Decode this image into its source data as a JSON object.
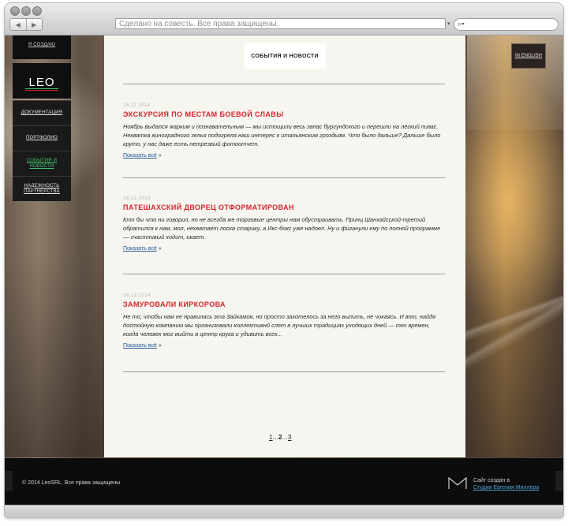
{
  "browser": {
    "address_text": "Сделано на совесть. Все права защищены.",
    "nav_back": "◀",
    "nav_forward": "▶",
    "search_icon": "search-icon",
    "addr_caret": "▾"
  },
  "site": {
    "top_link": "Я СОЗДАЮ",
    "logo_text": "LEO",
    "language_button": "IN ENGLISH",
    "nav": [
      {
        "label": "Документация"
      },
      {
        "label": "Портфолио"
      },
      {
        "label": "События и новости"
      },
      {
        "label": "Надежность партнерства"
      }
    ],
    "section_title": "События и новости",
    "posts": [
      {
        "date": "16.11.2014",
        "title": "ЭКСКУРСИЯ ПО МЕСТАМ БОЕВОЙ СЛАВЫ",
        "text": "Ноябрь выдался жарким и познавательным — мы истощили весь запас бургундского и перешли на лёгкий пивас. Нехватка виноградного зелья подогрела наш интерес к итальянским гроздьям. Что было дальше? Дальше было круто, у нас даже есть нетрезвый фотоотчет.",
        "more": "Показать всё",
        "arrow": "»"
      },
      {
        "date": "16.12.2014",
        "title": "ПАТЕШАХСКИЙ ДВОРЕЦ ОТФОРМАТИРОВАН",
        "text": "Кто бы что ни говорил, но не всегда же торговые центры нам обустраивать. Принц Шанхайсской-третий обратился к нам, мол, нехватает лоска старику, а Икс-бокс уже надоел. Ну и фиганули ему по полной программе — счастливый ходит, икает.",
        "more": "Показать всё",
        "arrow": "»"
      },
      {
        "date": "16.13.2014",
        "title": "ЗАМУРОВАЛИ КИРКОРОВА",
        "text": "Не то, чтобы нам не нравилась эта Зайкамоя, но просто захотелось за него выпить, не чокаясь. И вот, найдя достойную компанию мы организовали коллективнй слет в лучших традициях уходящих дней — тех времен, когда человек мог выйти в центр круга и удивить всех...",
        "more": "Показать всё",
        "arrow": "»"
      }
    ],
    "pagination": {
      "p1": "1",
      "sep1": "...",
      "p2": "2",
      "sep2": "...",
      "p3": "3"
    },
    "footer": {
      "copyright": "© 2014 LeoSRL. Все права защищены",
      "credit_line1": "Сайт создан в",
      "credit_link": "Студии Евгения Миллера"
    }
  },
  "colors": {
    "accent_red": "#d7262f",
    "active_nav": "#46c46e",
    "link_blue": "#1e5a9a"
  }
}
